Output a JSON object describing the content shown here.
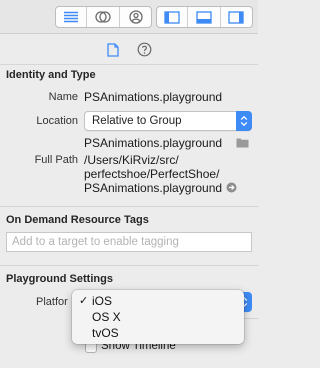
{
  "toolbar": {
    "left_group": [
      "justify-text-icon",
      "history-icon",
      "person-icon"
    ],
    "right_group": [
      "left-panel-icon",
      "bottom-panel-icon",
      "right-panel-icon"
    ],
    "accent": "#3e8bf6"
  },
  "tabs": [
    "document-icon",
    "help-icon"
  ],
  "identity": {
    "title": "Identity and Type",
    "name_label": "Name",
    "name_value": "PSAnimations.playground",
    "location_label": "Location",
    "location_value": "Relative to Group",
    "file_name": "PSAnimations.playground",
    "full_path_label": "Full Path",
    "full_path_lines": [
      "/Users/KiRviz/src/",
      "perfectshoe/PerfectShoe/",
      "PSAnimations.playground"
    ]
  },
  "on_demand": {
    "title": "On Demand Resource Tags",
    "placeholder": "Add to a target to enable tagging"
  },
  "playground": {
    "title": "Playground Settings",
    "platform_label": "Platfor",
    "options": [
      "iOS",
      "OS X",
      "tvOS"
    ],
    "selected": "iOS",
    "timeline_label": "Show Timeline"
  }
}
